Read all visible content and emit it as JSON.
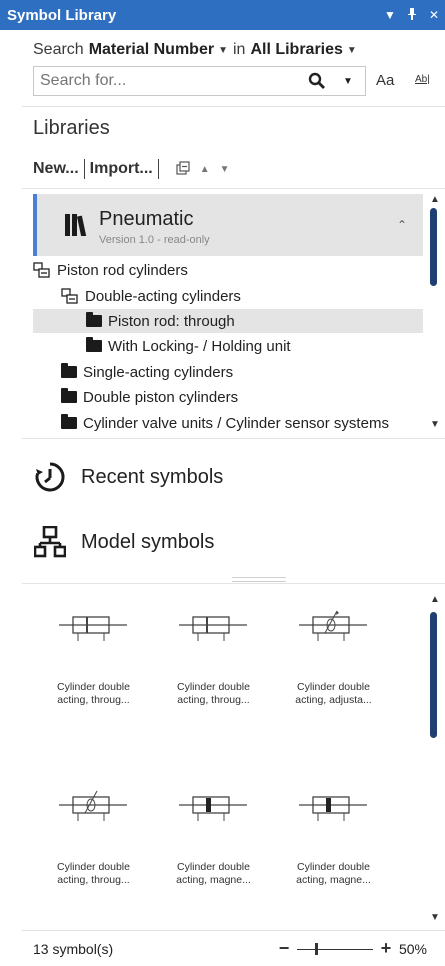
{
  "window": {
    "title": "Symbol Library"
  },
  "search": {
    "prefix": "Search",
    "field": "Material Number",
    "in_word": "in",
    "scope": "All Libraries",
    "placeholder": "Search for...",
    "case_toggle": "Aa",
    "whole_word_toggle": "Ab|"
  },
  "libraries": {
    "heading": "Libraries",
    "new_label": "New...",
    "import_label": "Import..."
  },
  "library": {
    "name": "Pneumatic",
    "version": "Version 1.0 - read-only"
  },
  "tree": [
    {
      "label": "Piston rod cylinders",
      "icon": "tree-expanded-icon",
      "level": 0,
      "selected": false
    },
    {
      "label": "Double-acting cylinders",
      "icon": "tree-expanded-icon",
      "level": 1,
      "selected": false
    },
    {
      "label": "Piston rod: through",
      "icon": "folder-icon",
      "level": 2,
      "selected": true
    },
    {
      "label": "With Locking- / Holding unit",
      "icon": "folder-icon",
      "level": 2,
      "selected": false
    },
    {
      "label": "Single-acting cylinders",
      "icon": "folder-icon",
      "level": 1,
      "selected": false
    },
    {
      "label": "Double piston cylinders",
      "icon": "folder-icon",
      "level": 1,
      "selected": false
    },
    {
      "label": "Cylinder valve units / Cylinder sensor systems",
      "icon": "folder-icon",
      "level": 1,
      "selected": false
    }
  ],
  "sections": {
    "recent": "Recent symbols",
    "model": "Model symbols"
  },
  "symbols": [
    {
      "line1": "Cylinder double",
      "line2": "acting, throug..."
    },
    {
      "line1": "Cylinder double",
      "line2": "acting, throug..."
    },
    {
      "line1": "Cylinder double",
      "line2": "acting, adjusta..."
    },
    {
      "line1": "Cylinder double",
      "line2": "acting, throug..."
    },
    {
      "line1": "Cylinder double",
      "line2": "acting, magne..."
    },
    {
      "line1": "Cylinder double",
      "line2": "acting, magne..."
    }
  ],
  "status": {
    "count": "13 symbol(s)",
    "zoom": "50%",
    "zoom_level": 0.25
  },
  "colors": {
    "titlebar": "#2f6fc2",
    "accent": "#4a7fd6",
    "scroll_thumb": "#1f3f73",
    "selection": "#e4e4e4"
  }
}
